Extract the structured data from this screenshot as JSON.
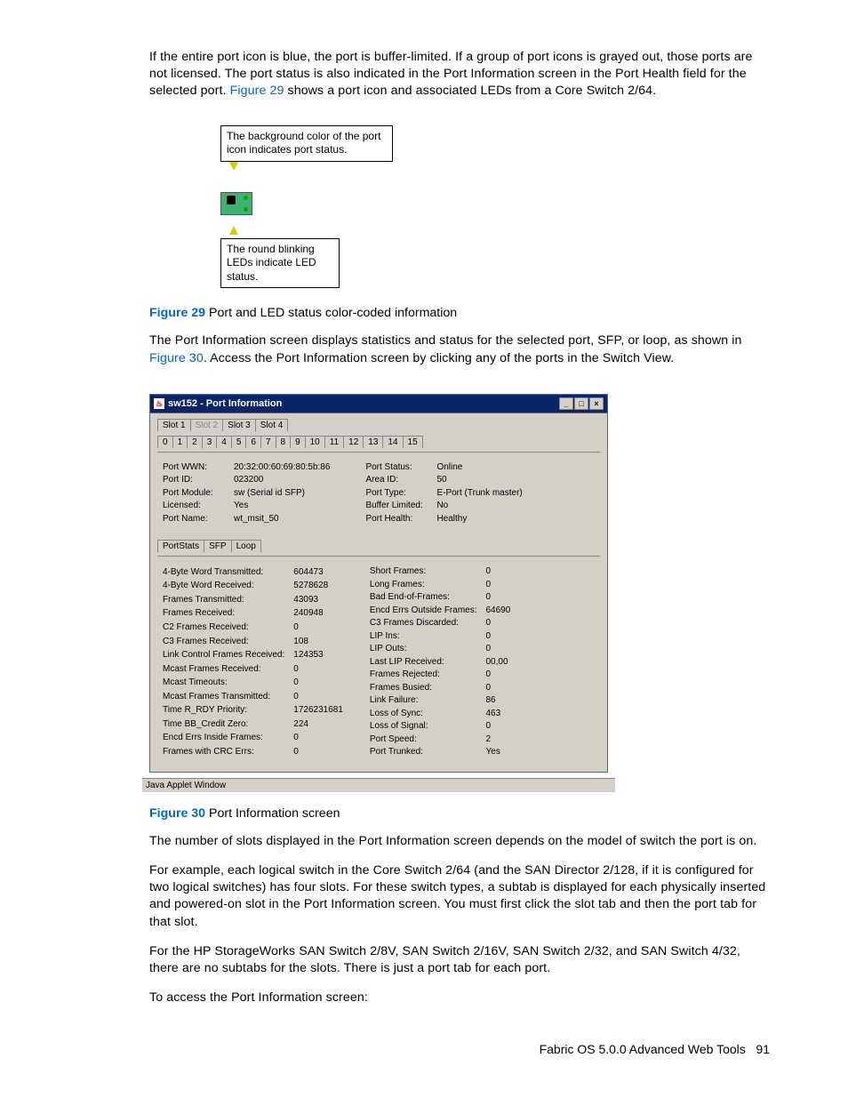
{
  "paragraphs": {
    "p1a": "If the entire port icon is blue, the port is buffer-limited. If a group of port icons is grayed out, those ports are not licensed. The port status is also indicated in the Port Information screen in the Port Health field for the selected port. ",
    "p1_link": "Figure 29",
    "p1b": " shows a port icon and associated LEDs from a Core Switch 2/64.",
    "p2a": "The Port Information screen displays statistics and status for the selected port, SFP, or loop, as shown in ",
    "p2_link": "Figure 30",
    "p2b": ". Access the Port Information screen by clicking any of the ports in the Switch View.",
    "p3": "The number of slots displayed in the Port Information screen depends on the model of switch the port is on.",
    "p4": "For example, each logical switch in the Core Switch 2/64 (and the SAN Director 2/128, if it is configured for two logical switches) has four slots. For these switch types, a subtab is displayed for each physically inserted and powered-on slot in the Port Information screen. You must first click the slot tab and then the port tab for that slot.",
    "p5": "For the HP StorageWorks SAN Switch 2/8V, SAN Switch 2/16V, SAN Switch 2/32, and SAN Switch 4/32, there are no subtabs for the slots. There is just a port tab for each port.",
    "p6": "To access the Port Information screen:"
  },
  "fig29": {
    "label": "Figure 29",
    "caption": " Port and LED status color-coded information",
    "callout_top": "The background color of the port icon indicates port status.",
    "callout_bottom": "The round blinking LEDs indicate LED status."
  },
  "fig30": {
    "label": "Figure 30",
    "caption": " Port Information screen"
  },
  "window": {
    "title": "sw152 - Port Information",
    "min": "_",
    "max": "□",
    "close": "×",
    "slot_tabs": [
      "Slot 1",
      "Slot 2",
      "Slot 3",
      "Slot 4"
    ],
    "slot_active": 3,
    "slot_disabled": 1,
    "port_tabs": [
      "0",
      "1",
      "2",
      "3",
      "4",
      "5",
      "6",
      "7",
      "8",
      "9",
      "10",
      "11",
      "12",
      "13",
      "14",
      "15"
    ],
    "port_active": 2,
    "info_left": [
      [
        "Port WWN:",
        "20:32:00:60:69:80:5b:86"
      ],
      [
        "Port ID:",
        "023200"
      ],
      [
        "Port Module:",
        "sw (Serial id SFP)"
      ],
      [
        "Licensed:",
        "Yes"
      ],
      [
        "Port Name:",
        "wt_msit_50"
      ]
    ],
    "info_right": [
      [
        "Port Status:",
        "Online"
      ],
      [
        "Area ID:",
        "50"
      ],
      [
        "Port Type:",
        "E-Port (Trunk master)"
      ],
      [
        "Buffer Limited:",
        "No"
      ],
      [
        "Port Health:",
        "Healthy"
      ]
    ],
    "sub_tabs": [
      "PortStats",
      "SFP",
      "Loop"
    ],
    "sub_active": 0,
    "stats_left": [
      [
        "4-Byte Word Transmitted:",
        "604473"
      ],
      [
        "4-Byte Word Received:",
        "5278628"
      ],
      [
        "Frames Transmitted:",
        "43093"
      ],
      [
        "Frames Received:",
        "240948"
      ],
      [
        "C2 Frames Received:",
        "0"
      ],
      [
        "C3 Frames Received:",
        "108"
      ],
      [
        "Link Control Frames Received:",
        "124353"
      ],
      [
        "Mcast Frames Received:",
        "0"
      ],
      [
        "Mcast Timeouts:",
        "0"
      ],
      [
        "Mcast Frames Transmitted:",
        "0"
      ],
      [
        "Time R_RDY Priority:",
        "1726231681"
      ],
      [
        "Time BB_Credit Zero:",
        "224"
      ],
      [
        "Encd Errs Inside Frames:",
        "0"
      ],
      [
        "Frames with CRC Errs:",
        "0"
      ]
    ],
    "stats_right": [
      [
        "Short Frames:",
        "0"
      ],
      [
        "Long Frames:",
        "0"
      ],
      [
        "Bad End-of-Frames:",
        "0"
      ],
      [
        "Encd Errs Outside Frames:",
        "64690"
      ],
      [
        "C3 Frames Discarded:",
        "0"
      ],
      [
        "LIP Ins:",
        "0"
      ],
      [
        "LIP Outs:",
        "0"
      ],
      [
        "Last LIP Received:",
        "00,00"
      ],
      [
        "Frames Rejected:",
        "0"
      ],
      [
        "Frames Busied:",
        "0"
      ],
      [
        "Link Failure:",
        "86"
      ],
      [
        "Loss of Sync:",
        "463"
      ],
      [
        "Loss of Signal:",
        "0"
      ],
      [
        "Port Speed:",
        "2"
      ],
      [
        "Port Trunked:",
        "Yes"
      ]
    ],
    "statusline": "Java Applet Window"
  },
  "footer": {
    "text": "Fabric OS 5.0.0 Advanced Web Tools",
    "page": "91"
  }
}
